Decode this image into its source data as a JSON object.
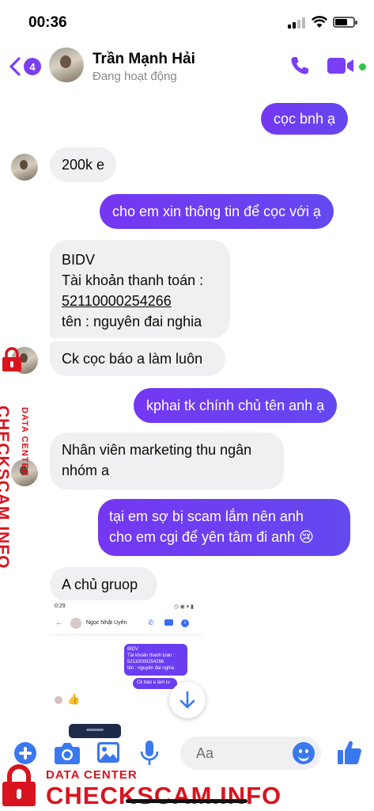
{
  "status_bar": {
    "time": "00:36"
  },
  "header": {
    "back_badge": "4",
    "contact_name": "Trần Mạnh Hải",
    "contact_status": "Đang hoạt động",
    "accent_color": "#7a3ff2",
    "icons": [
      "back-chevron-icon",
      "phone-icon",
      "video-camera-icon"
    ]
  },
  "messages": [
    {
      "direction": "out",
      "lines": [
        "cọc bnh ạ"
      ]
    },
    {
      "direction": "in",
      "lines": [
        "200k e"
      ]
    },
    {
      "direction": "out",
      "lines": [
        "cho em xin thông tin để cọc với ạ"
      ]
    },
    {
      "direction": "in",
      "lines": [
        "BIDV",
        "Tài khoản thanh toán :",
        "52110000254266",
        "tên : nguyên đai nghia"
      ]
    },
    {
      "direction": "in",
      "lines": [
        "Ck cọc báo a làm luôn"
      ]
    },
    {
      "direction": "out",
      "lines": [
        "kphai tk chính chủ tên anh ạ"
      ]
    },
    {
      "direction": "in",
      "lines": [
        "Nhân viên marketing thu ngân",
        "nhóm a"
      ]
    },
    {
      "direction": "out",
      "lines": [
        "tại em sợ bị scam lắm nên anh",
        "cho em cgi để yên tâm đi anh 😢"
      ]
    },
    {
      "direction": "in",
      "lines": [
        "A chủ gruop"
      ]
    }
  ],
  "shared_screenshot": {
    "time": "0:29",
    "contact_name": "Ngọc Nhật Uyên",
    "bubble_lines": [
      "BIDV",
      "Tài khoản thanh toán :",
      "52110000254266",
      "tên : nguyên đai nghia"
    ],
    "bubble_2": "Ck báo a làm lu"
  },
  "composer": {
    "placeholder": "Aa",
    "icons": [
      "plus-icon",
      "camera-icon",
      "photo-icon",
      "microphone-icon",
      "emoji-icon",
      "thumbs-up-icon"
    ]
  },
  "watermark": {
    "small": "DATA CENTER",
    "big": "CHECKSCAM.INFO",
    "color": "#d8141e"
  },
  "colors": {
    "outgoing_bubble": "#7537f2",
    "incoming_bubble": "#f0f0f2",
    "online": "#31c24d",
    "composer_icons": "#3a78f0"
  }
}
